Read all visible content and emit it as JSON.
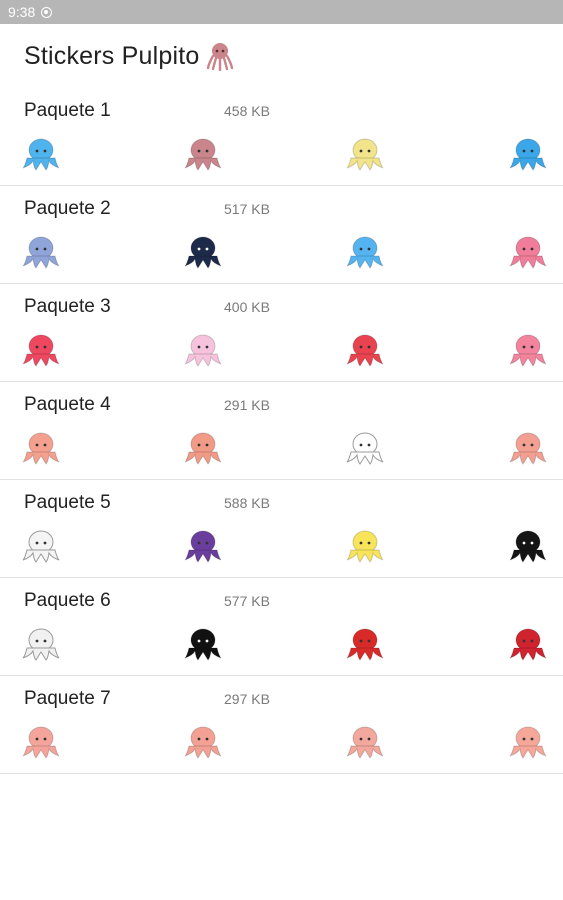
{
  "status_bar": {
    "time": "9:38"
  },
  "app": {
    "title": "Stickers Pulpito",
    "title_icon": "octopus-icon"
  },
  "colors": {
    "status_bar": "#b6b6b6",
    "divider": "#e2e2e2"
  },
  "packs": [
    {
      "name": "Paquete 1",
      "size": "458 KB",
      "stickers": [
        {
          "color": "#4fb3ee",
          "caption": ""
        },
        {
          "color": "#c9858b",
          "caption": ""
        },
        {
          "color": "#f2e48a",
          "caption": ""
        },
        {
          "color": "#3aa8e8",
          "caption": ""
        }
      ]
    },
    {
      "name": "Paquete 2",
      "size": "517 KB",
      "stickers": [
        {
          "color": "#8fa4d8",
          "caption": ""
        },
        {
          "color": "#1e2a4a",
          "caption": ""
        },
        {
          "color": "#55b4ef",
          "caption": ""
        },
        {
          "color": "#f07d9a",
          "caption": ""
        }
      ]
    },
    {
      "name": "Paquete 3",
      "size": "400 KB",
      "stickers": [
        {
          "color": "#ee4760",
          "caption": ""
        },
        {
          "color": "#f7c3dc",
          "caption": ""
        },
        {
          "color": "#e8434f",
          "caption": ""
        },
        {
          "color": "#f2849e",
          "caption": ""
        }
      ]
    },
    {
      "name": "Paquete 4",
      "size": "291 KB",
      "stickers": [
        {
          "color": "#f4a08f",
          "caption": ""
        },
        {
          "color": "#f19a86",
          "caption": ""
        },
        {
          "color": "#ffffff",
          "caption": ""
        },
        {
          "color": "#f3a093",
          "caption": ""
        }
      ]
    },
    {
      "name": "Paquete 5",
      "size": "588 KB",
      "stickers": [
        {
          "color": "#f4f4f4",
          "caption": ""
        },
        {
          "color": "#6a3e9c",
          "caption": ""
        },
        {
          "color": "#f8e45a",
          "caption": ""
        },
        {
          "color": "#151515",
          "caption": ""
        }
      ]
    },
    {
      "name": "Paquete 6",
      "size": "577 KB",
      "stickers": [
        {
          "color": "#f1f1f1",
          "caption": ""
        },
        {
          "color": "#111111",
          "caption": ""
        },
        {
          "color": "#d92a2a",
          "caption": ""
        },
        {
          "color": "#d0222f",
          "caption": ""
        }
      ]
    },
    {
      "name": "Paquete 7",
      "size": "297 KB",
      "stickers": [
        {
          "color": "#f4a49a",
          "caption": ""
        },
        {
          "color": "#f3a195",
          "caption": ""
        },
        {
          "color": "#f2a89c",
          "caption": ""
        },
        {
          "color": "#f5a89a",
          "caption": ""
        }
      ]
    }
  ]
}
